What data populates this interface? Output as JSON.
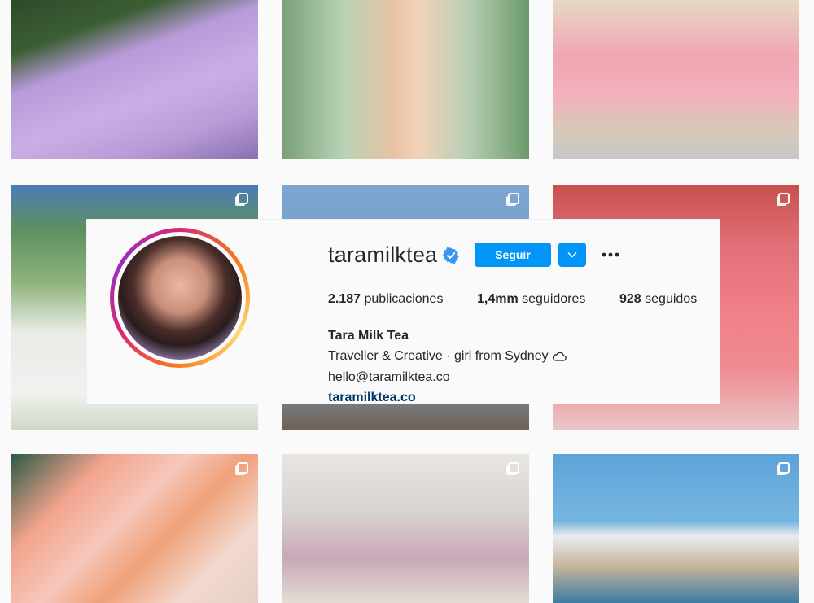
{
  "profile": {
    "username": "taramilktea",
    "verified": true,
    "follow_label": "Seguir",
    "dropdown_icon": "chevron-down-icon",
    "more_icon": "more-options-icon",
    "stats": {
      "posts_value": "2.187",
      "posts_label": "publicaciones",
      "followers_value": "1,4mm",
      "followers_label": "seguidores",
      "following_value": "928",
      "following_label": "seguidos"
    },
    "bio": {
      "name": "Tara Milk Tea",
      "line1": "Traveller & Creative · girl from Sydney",
      "line1_icon": "cloud-icon",
      "line2": "hello@taramilktea.co",
      "website": "taramilktea.co"
    }
  },
  "colors": {
    "follow_button": "#0095f6",
    "link": "#00376b",
    "text": "#262626",
    "background": "#fafafa"
  },
  "posts": [
    {
      "row": 1,
      "col": 1,
      "multi": false
    },
    {
      "row": 1,
      "col": 2,
      "multi": false
    },
    {
      "row": 1,
      "col": 3,
      "multi": false
    },
    {
      "row": 2,
      "col": 1,
      "multi": true
    },
    {
      "row": 2,
      "col": 2,
      "multi": true
    },
    {
      "row": 2,
      "col": 3,
      "multi": true
    },
    {
      "row": 3,
      "col": 1,
      "multi": true
    },
    {
      "row": 3,
      "col": 2,
      "multi": true
    },
    {
      "row": 3,
      "col": 3,
      "multi": true
    }
  ]
}
